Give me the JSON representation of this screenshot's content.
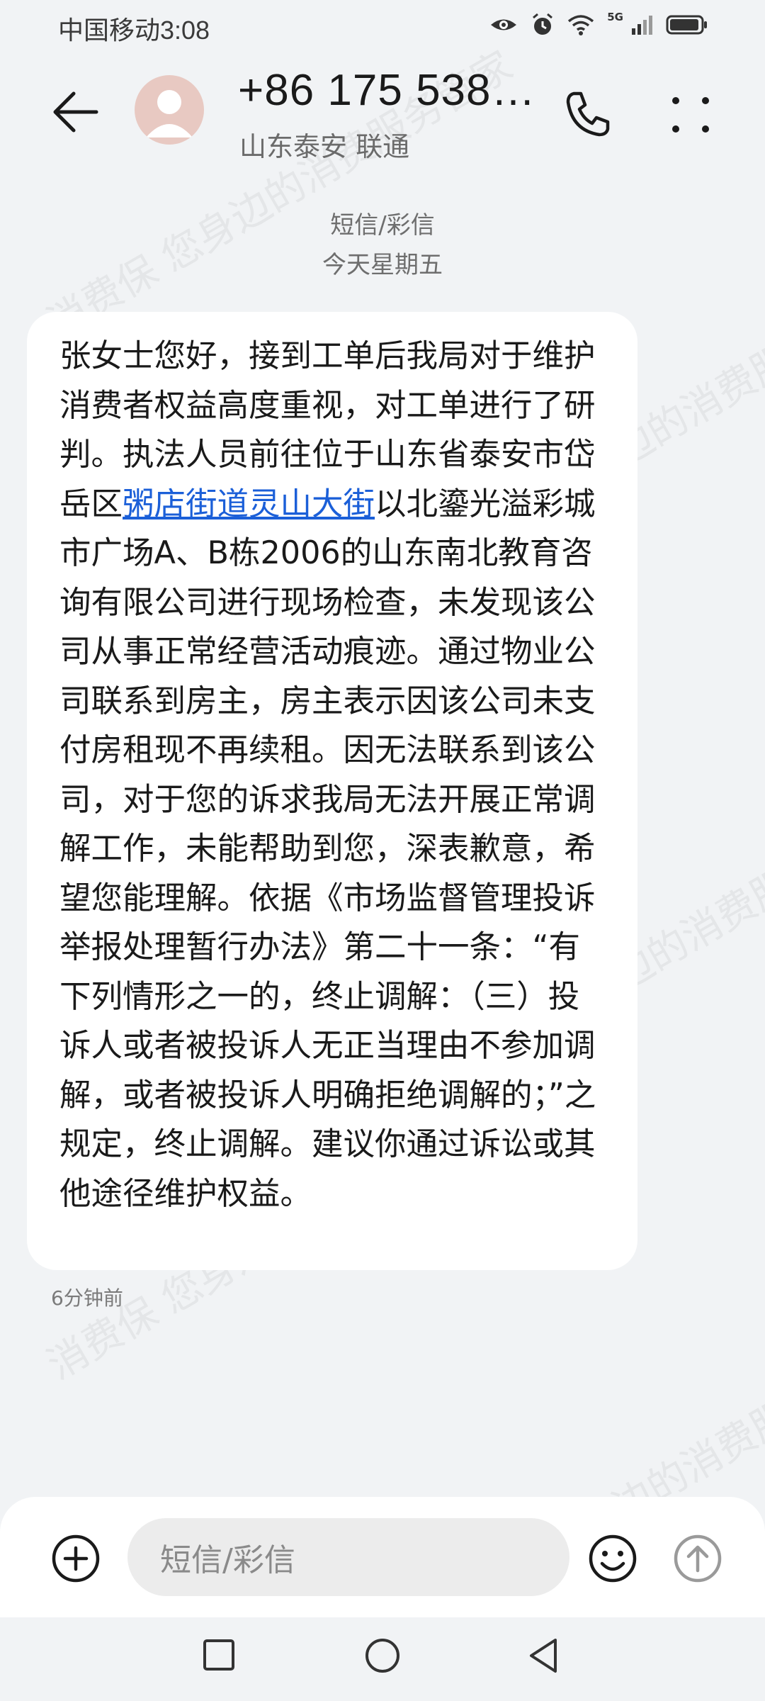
{
  "status_bar": {
    "carrier_time": "中国移动3:08",
    "network_badge": "5G",
    "icons": [
      "eye-icon",
      "alarm-icon",
      "wifi-icon",
      "signal-icon",
      "battery-icon"
    ]
  },
  "header": {
    "back_icon": "back-arrow-icon",
    "contact_number": "+86 175 538…",
    "contact_location": "山东泰安 联通",
    "call_icon": "phone-icon",
    "more_icon": "more-dots-icon"
  },
  "conversation": {
    "message_type": "短信/彩信",
    "date_label": "今天星期五"
  },
  "message": {
    "text_before_link": "张女士您好，接到工单后我局对于维护消费者权益高度重视，对工单进行了研判。执法人员前往位于山东省泰安市岱岳区",
    "link_text": "粥店街道灵山大街",
    "text_after_link": "以北鎏光溢彩城市广场A、B栋2006的山东南北教育咨询有限公司进行现场检查，未发现该公司从事正常经营活动痕迹。通过物业公司联系到房主，房主表示因该公司未支付房租现不再续租。因无法联系到该公司，对于您的诉求我局无法开展正常调解工作，未能帮助到您，深表歉意，希望您能理解。依据《市场监督管理投诉举报处理暂行办法》第二十一条：“有下列情形之一的，终止调解：（三）投诉人或者被投诉人无正当理由不参加调解，或者被投诉人明确拒绝调解的；”之规定，终止调解。建议你通过诉讼或其他途径维护权益。",
    "timestamp": "6分钟前"
  },
  "watermark": {
    "text": "消费保 您身边的消费服务管家"
  },
  "compose": {
    "add_icon": "plus-circle-icon",
    "input_placeholder": "短信/彩信",
    "emoji_icon": "smiley-icon",
    "send_icon": "send-arrow-icon"
  },
  "navbar": {
    "icons": [
      "recents-square-icon",
      "home-circle-icon",
      "back-triangle-icon"
    ]
  },
  "colors": {
    "background": "#f1f3f5",
    "bubble": "#ffffff",
    "link": "#1b5fd8",
    "avatar": "#e8c9c2"
  }
}
